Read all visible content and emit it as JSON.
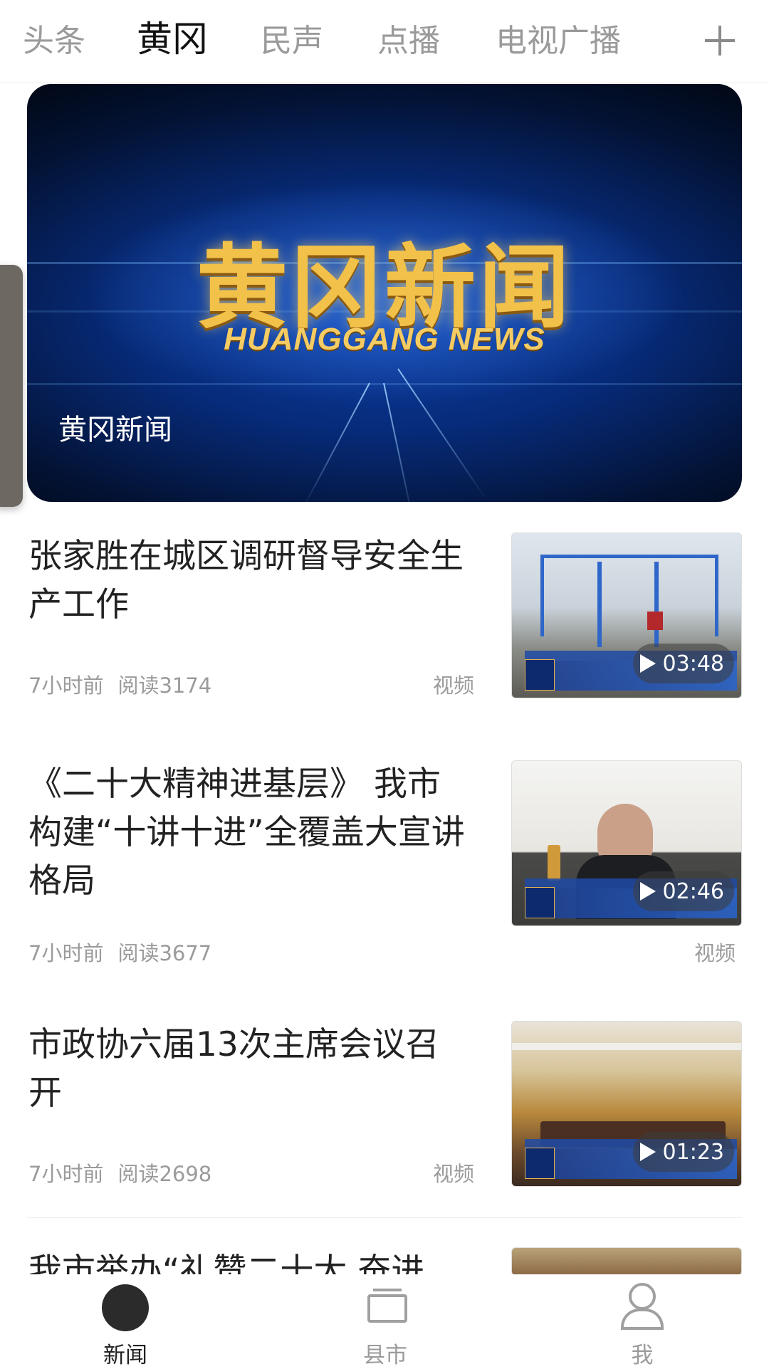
{
  "tabs": [
    {
      "label": "头条",
      "active": false
    },
    {
      "label": "黄冈",
      "active": true
    },
    {
      "label": "民声",
      "active": false
    },
    {
      "label": "点播",
      "active": false
    },
    {
      "label": "电视广播",
      "active": false
    }
  ],
  "add_tab_icon": "plus-icon",
  "hero": {
    "logo_cn": "黄冈新闻",
    "logo_en": "HUANGGANG NEWS",
    "caption": "黄冈新闻"
  },
  "news": [
    {
      "title": "张家胜在城区调研督导安全生产工作",
      "time": "7小时前",
      "reads": "阅读3174",
      "tag": "视频",
      "duration": "03:48"
    },
    {
      "title": "《二十大精神进基层》 我市构建“十讲十进”全覆盖大宣讲格局",
      "time": "7小时前",
      "reads": "阅读3677",
      "tag": "视频",
      "duration": "02:46"
    },
    {
      "title": "市政协六届13次主席会议召开",
      "time": "7小时前",
      "reads": "阅读2698",
      "tag": "视频",
      "duration": "01:23"
    },
    {
      "title": "我市举办“礼赞二十大 奋进"
    }
  ],
  "bottom_nav": [
    {
      "label": "新闻",
      "icon": "news-dot-icon",
      "active": true
    },
    {
      "label": "县市",
      "icon": "county-icon",
      "active": false
    },
    {
      "label": "我",
      "icon": "user-icon",
      "active": false
    }
  ]
}
